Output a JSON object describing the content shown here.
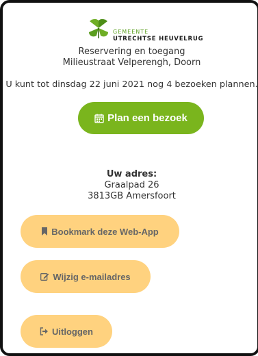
{
  "header": {
    "logo_line1": "GEMEENTE",
    "logo_line2": "UTRECHTSE HEUVELRUG",
    "subtitle_line1": "Reservering en toegang",
    "subtitle_line2": "Milieustraat Velperengh, Doorn"
  },
  "notice": "U kunt tot dinsdag 22 juni 2021 nog 4 bezoeken plannen.",
  "plan_button": {
    "label": "Plan een bezoek",
    "icon": "calendar-icon"
  },
  "address": {
    "label": "Uw adres:",
    "street": "Graalpad 26",
    "postal_city": "3813GB Amersfoort"
  },
  "actions": {
    "bookmark_label": "Bookmark deze Web-App",
    "email_label": "Wijzig e-mailadres",
    "logout_label": "Uitloggen"
  },
  "colors": {
    "primary_green": "#7ab51d",
    "secondary_pill": "#ffd27f",
    "text": "#333333"
  }
}
